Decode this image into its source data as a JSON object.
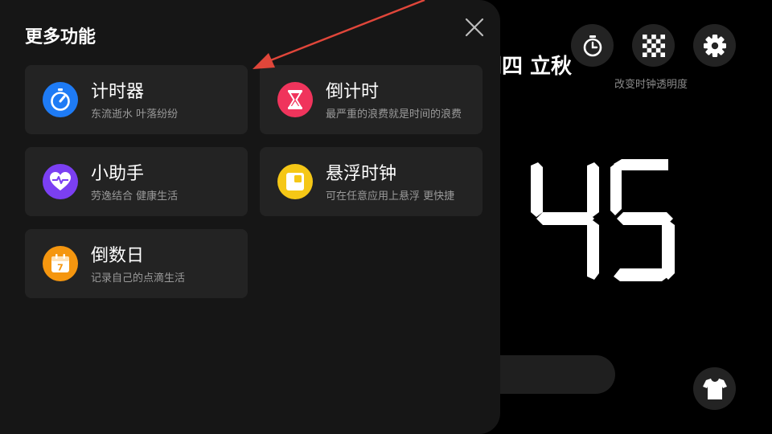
{
  "background": {
    "date_text": "朔四 立秋",
    "top_buttons": [
      {
        "icon": "stopwatch-icon"
      },
      {
        "icon": "checker-icon"
      },
      {
        "icon": "gear-icon"
      }
    ],
    "transparency_label": "改变时钟透明度",
    "clock_digits": "45",
    "theme_button_icon": "tshirt-icon"
  },
  "panel": {
    "title": "更多功能",
    "close_icon": "close-icon",
    "cards": [
      {
        "title": "计时器",
        "subtitle": "东流逝水 叶落纷纷",
        "icon": "stopwatch-icon",
        "color": "#1E7BF5"
      },
      {
        "title": "倒计时",
        "subtitle": "最严重的浪费就是时间的浪费",
        "icon": "hourglass-icon",
        "color": "#F0345C"
      },
      {
        "title": "小助手",
        "subtitle": "劳逸结合 健康生活",
        "icon": "heart-pulse-icon",
        "color": "#7B3FF2"
      },
      {
        "title": "悬浮时钟",
        "subtitle": "可在任意应用上悬浮 更快捷",
        "icon": "floating-window-icon",
        "color": "#F5C716"
      },
      {
        "title": "倒数日",
        "subtitle": "记录自己的点滴生活",
        "icon": "calendar-icon",
        "calendar_day": "7",
        "color": "#F5960F"
      }
    ]
  },
  "annotation": {
    "arrow_color": "#E0463A"
  }
}
